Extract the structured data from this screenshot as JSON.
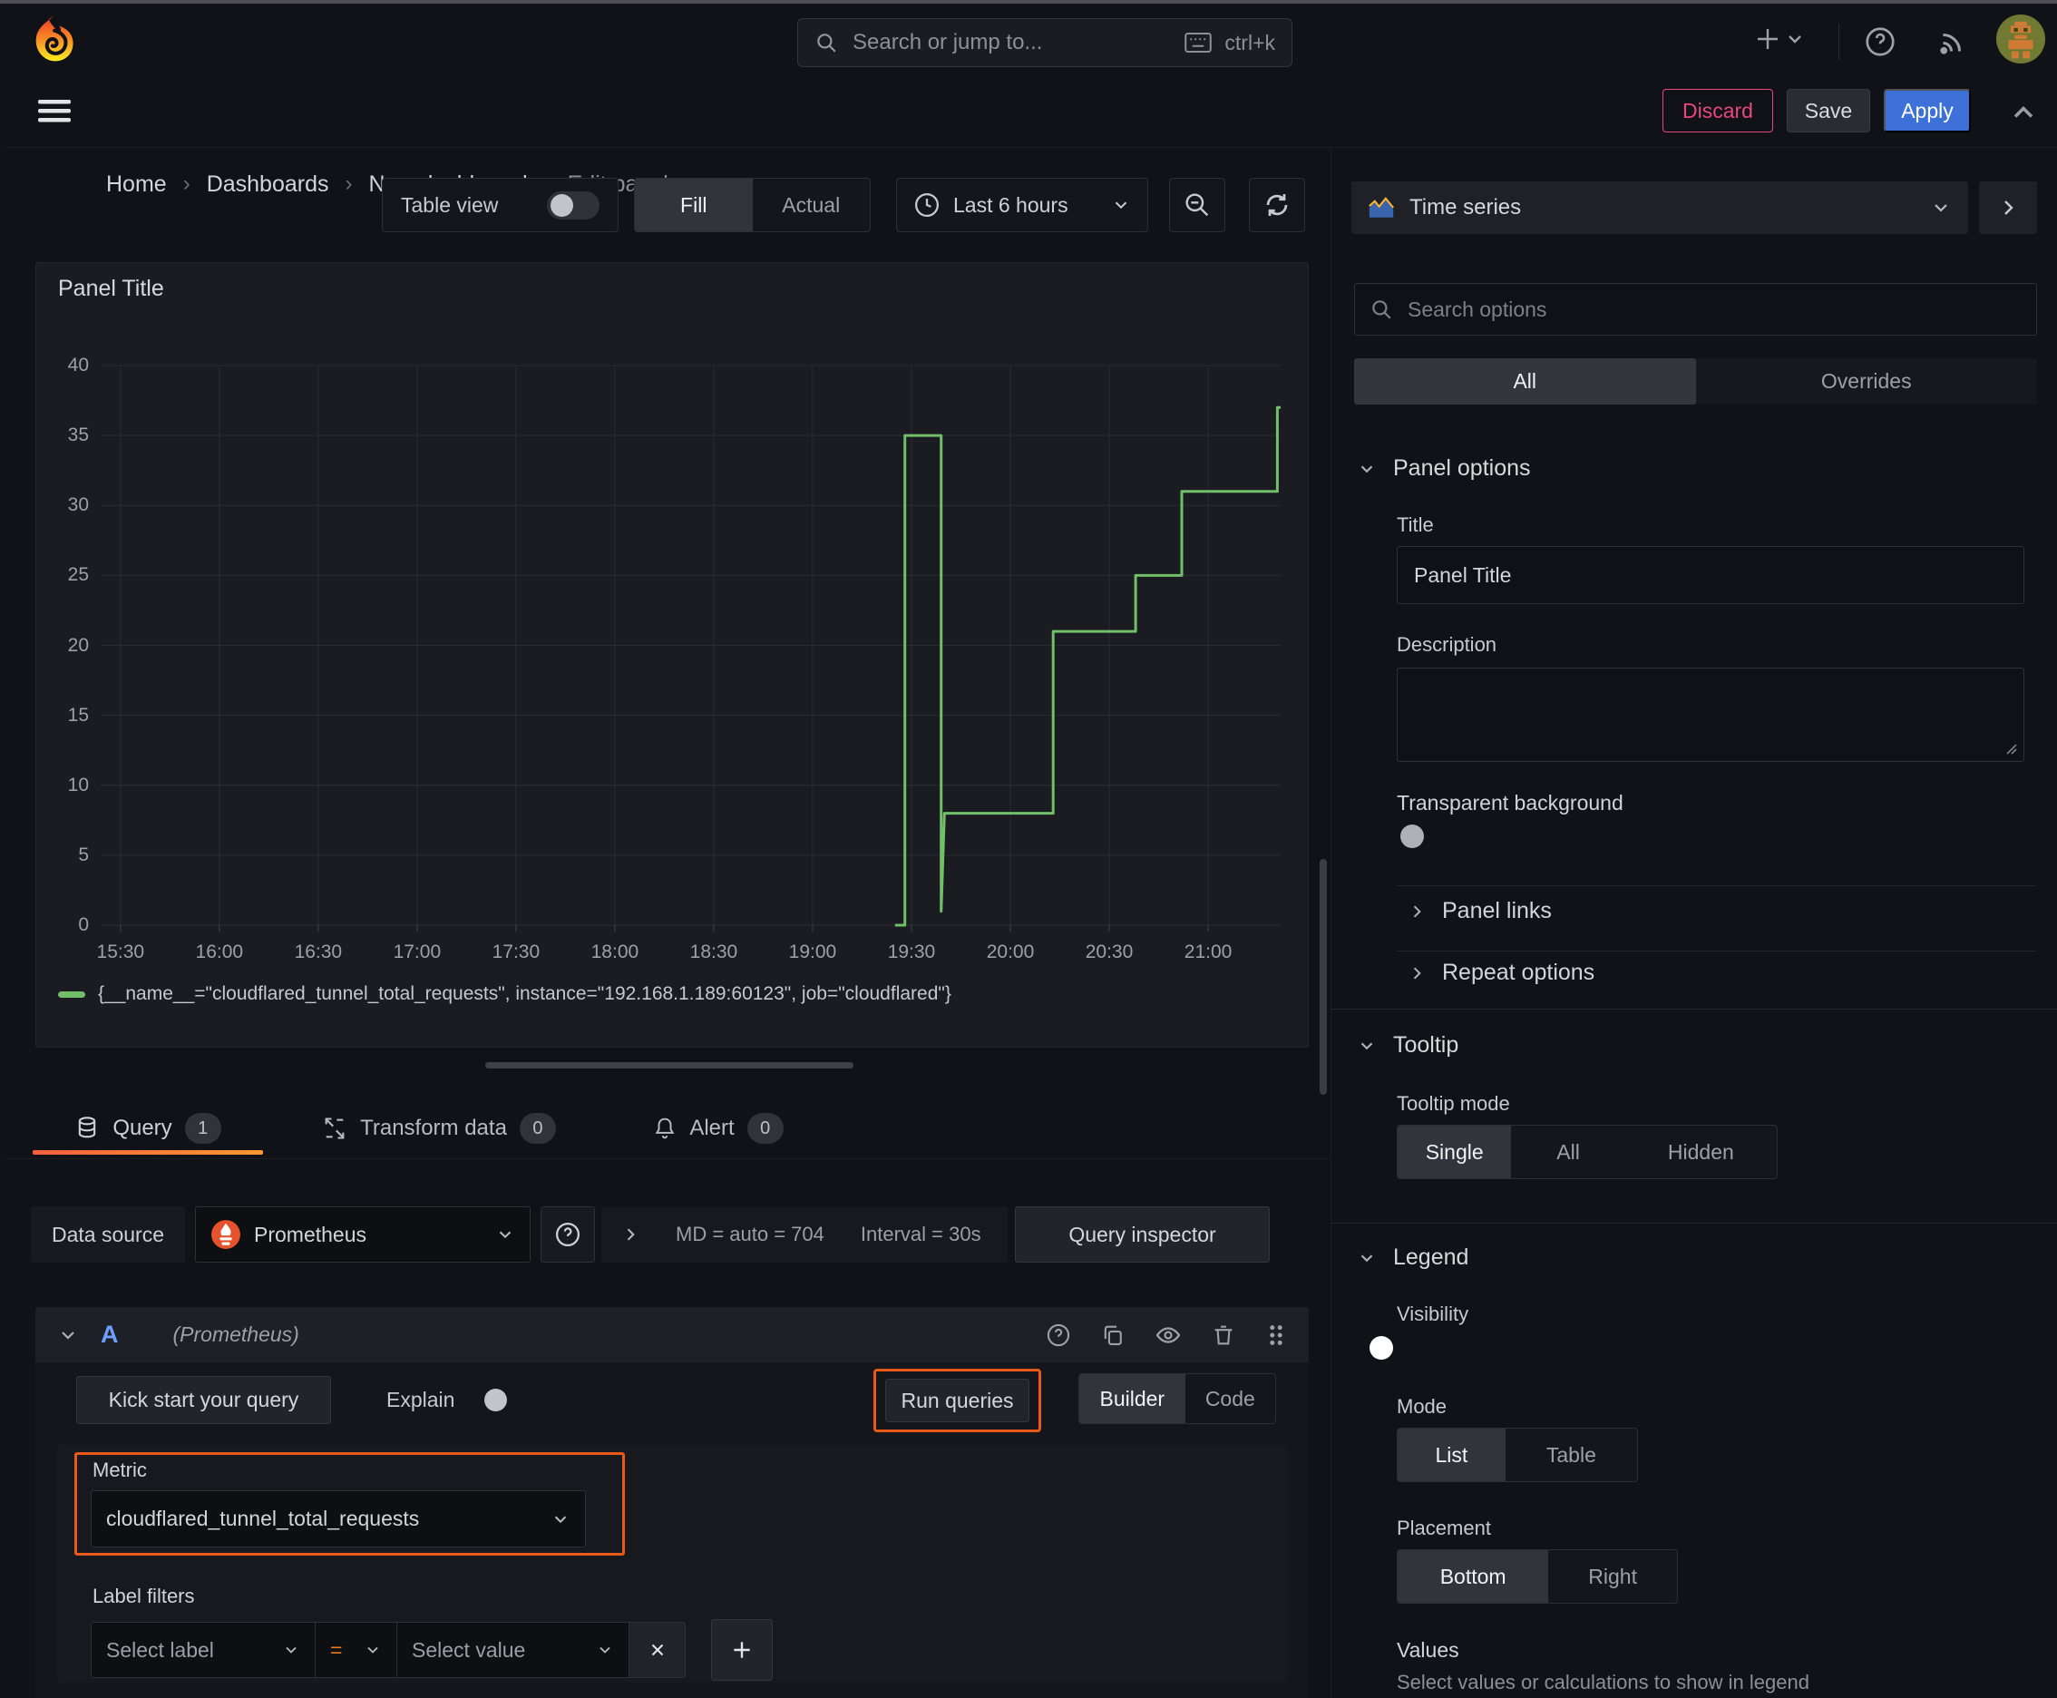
{
  "theme": {
    "accent_orange": "#e8591a",
    "primary_blue": "#3d71d9",
    "danger_pink": "#e8477c",
    "series_green": "#73bf69"
  },
  "nav": {
    "search_placeholder": "Search or jump to...",
    "search_shortcut": "ctrl+k"
  },
  "breadcrumb": {
    "separator": "›",
    "items": [
      "Home",
      "Dashboards",
      "New dashboard",
      "Edit panel"
    ]
  },
  "actions": {
    "discard": "Discard",
    "save": "Save",
    "apply": "Apply"
  },
  "panel_toolbar": {
    "table_view": "Table view",
    "fill": "Fill",
    "actual": "Actual",
    "time_range": "Last 6 hours"
  },
  "viz_picker": {
    "value": "Time series"
  },
  "options_pane": {
    "search_placeholder": "Search options",
    "tab_all": "All",
    "tab_overrides": "Overrides",
    "panel_options": {
      "header": "Panel options",
      "title_label": "Title",
      "title_value": "Panel Title",
      "description_label": "Description",
      "transparent_label": "Transparent background"
    },
    "collapsed": {
      "panel_links": "Panel links",
      "repeat_options": "Repeat options"
    },
    "tooltip": {
      "header": "Tooltip",
      "mode_label": "Tooltip mode",
      "modes": [
        "Single",
        "All",
        "Hidden"
      ],
      "selected_mode": "Single"
    },
    "legend": {
      "header": "Legend",
      "visibility_label": "Visibility",
      "mode_label": "Mode",
      "modes": [
        "List",
        "Table"
      ],
      "selected_mode": "List",
      "placement_label": "Placement",
      "placements": [
        "Bottom",
        "Right"
      ],
      "selected_placement": "Bottom",
      "values_label": "Values",
      "values_help": "Select values or calculations to show in legend"
    }
  },
  "query_tabs": {
    "query": "Query",
    "query_count": "1",
    "transform": "Transform data",
    "transform_count": "0",
    "alert": "Alert",
    "alert_count": "0"
  },
  "datasource_row": {
    "label": "Data source",
    "name": "Prometheus",
    "md_stat": "MD = auto = 704",
    "interval_stat": "Interval = 30s",
    "inspector": "Query inspector"
  },
  "query_editor": {
    "ref_id": "A",
    "ds_hint": "(Prometheus)",
    "kick_start": "Kick start your query",
    "explain": "Explain",
    "run_queries": "Run queries",
    "builder": "Builder",
    "code": "Code",
    "metric_label": "Metric",
    "metric_value": "cloudflared_tunnel_total_requests",
    "label_filters_label": "Label filters",
    "select_label_placeholder": "Select label",
    "operator": "=",
    "select_value_placeholder": "Select value"
  },
  "chart_data": {
    "type": "line",
    "title": "Panel Title",
    "x_ticks": [
      "15:30",
      "16:00",
      "16:30",
      "17:00",
      "17:30",
      "18:00",
      "18:30",
      "19:00",
      "19:30",
      "20:00",
      "20:30",
      "21:00"
    ],
    "x_range": [
      "15:24",
      "21:22"
    ],
    "y_ticks": [
      0,
      5,
      10,
      15,
      20,
      25,
      30,
      35,
      40
    ],
    "ylim": [
      0,
      41
    ],
    "grid": true,
    "legend_position": "bottom",
    "series": [
      {
        "name": "{__name__=\"cloudflared_tunnel_total_requests\", instance=\"192.168.1.189:60123\", job=\"cloudflared\"}",
        "color": "#73bf69",
        "points": [
          [
            "19:25",
            0
          ],
          [
            "19:28",
            0
          ],
          [
            "19:28",
            35
          ],
          [
            "19:39",
            35
          ],
          [
            "19:39",
            1
          ],
          [
            "19:40",
            8
          ],
          [
            "20:13",
            8
          ],
          [
            "20:13",
            21
          ],
          [
            "20:38",
            21
          ],
          [
            "20:38",
            25
          ],
          [
            "20:52",
            25
          ],
          [
            "20:52",
            31
          ],
          [
            "21:21",
            31
          ],
          [
            "21:21",
            37
          ],
          [
            "21:22",
            37
          ]
        ]
      }
    ]
  }
}
